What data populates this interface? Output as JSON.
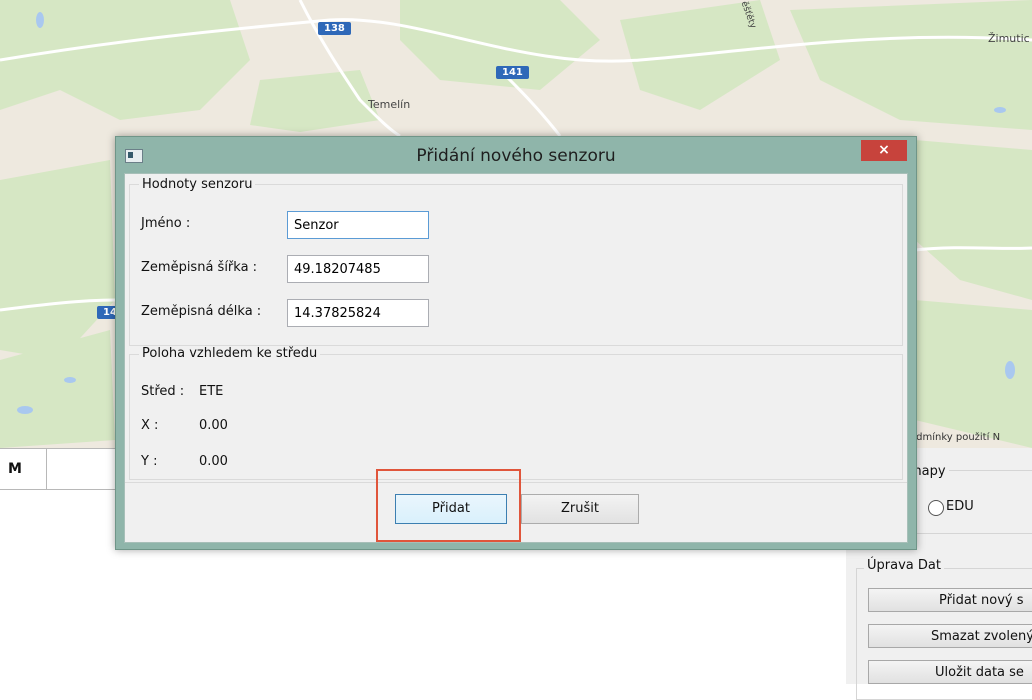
{
  "map": {
    "places": [
      "Temelín",
      "Žimutic",
      "ěšťěty"
    ],
    "road_shields": [
      "138",
      "141",
      "14"
    ],
    "terms_text": "odmínky použití   N"
  },
  "grid": {
    "cell_text": "M"
  },
  "dialog": {
    "title": "Přidání nového senzoru",
    "close_symbol": "×",
    "values_group": {
      "legend": "Hodnoty senzoru",
      "name_label": "Jméno :",
      "name_value": "Senzor",
      "lat_label": "Zeměpisná šířka :",
      "lat_value": "49.18207485",
      "lon_label": "Zeměpisná délka :",
      "lon_value": "14.37825824"
    },
    "position_group": {
      "legend": "Poloha vzhledem ke středu",
      "center_label": "Střed :",
      "center_value": "ETE",
      "x_label": "X :",
      "x_value": "0.00",
      "y_label": "Y :",
      "y_value": "0.00"
    },
    "buttons": {
      "add": "Přidat",
      "cancel": "Zrušit"
    }
  },
  "right_panel": {
    "map_group_title": "mapy",
    "radio_label": "EDU",
    "data_group_title": "Úprava Dat",
    "buttons": [
      "Přidat nový s",
      "Smazat zvolený",
      "Uložit data se"
    ]
  },
  "colors": {
    "highlight": "#e0553b",
    "dialog_frame": "#8fb5aa",
    "close": "#c7433c",
    "road_shield": "#2e68b8"
  }
}
